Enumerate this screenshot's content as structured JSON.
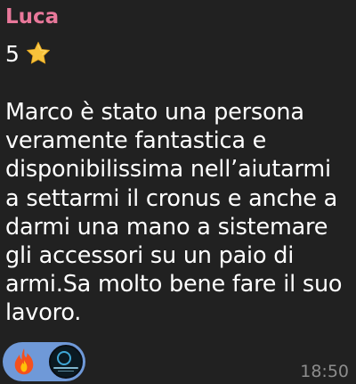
{
  "message": {
    "sender": "Luca",
    "rating_value": "5",
    "rating_icon": "star-icon",
    "text": "Marco è stato una persona veramente fantastica e disponibilissima nell’aiutarmi a settarmi il cronus e anche a darmi una mano a sistemare gli accessori su un paio di armi.Sa molto bene fare il suo lavoro.",
    "timestamp": "18:50"
  },
  "reaction": {
    "emoji_icon": "fire-icon",
    "avatar_icon": "reactor-avatar",
    "color": "#6f99d8"
  },
  "colors": {
    "background": "#212121",
    "sender": "#e8789a",
    "text": "#ffffff",
    "timestamp": "#8d8d8d"
  }
}
